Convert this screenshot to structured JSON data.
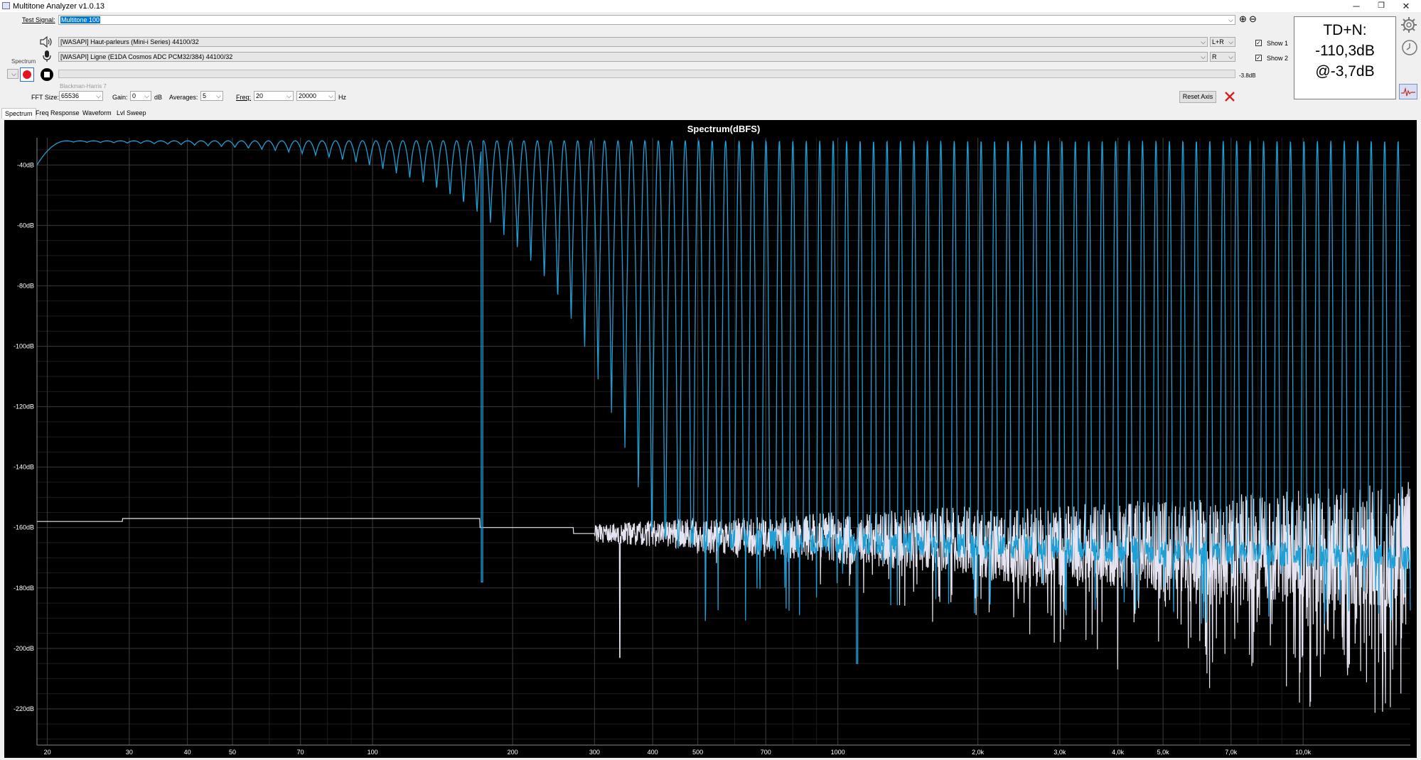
{
  "window": {
    "title": "Multitone Analyzer v1.0.13",
    "minimize_glyph": "─",
    "restore_glyph": "❐",
    "close_glyph": "✕"
  },
  "test_signal": {
    "label": "Test Signal:",
    "value": "Multitone 100",
    "add_icon": "⊕",
    "remove_icon": "⊖"
  },
  "output_device": {
    "value": "[WASAPI] Haut-parleurs (Mini-i Series) 44100/32",
    "channel": "L+R"
  },
  "input_device": {
    "value": "[WASAPI] Ligne (E1DA Cosmos ADC PCM32/384) 44100/32",
    "channel": "R"
  },
  "mode": {
    "label": "Spectrum"
  },
  "level": {
    "value": "-3.8dB",
    "fill_fraction": 0.0
  },
  "window_function": "Blackman-Harris 7",
  "fft_size": {
    "label": "FFT Size:",
    "value": "65536"
  },
  "gain": {
    "label": "Gain:",
    "value": "0",
    "unit": "dB"
  },
  "averages": {
    "label": "Averages:",
    "value": "5"
  },
  "freq": {
    "label": "Freq:",
    "from": "20",
    "to": "20000",
    "unit": "Hz"
  },
  "reset_axis": {
    "label": "Reset Axis"
  },
  "show1": {
    "label": "Show 1",
    "checked": true
  },
  "show2": {
    "label": "Show 2",
    "checked": true
  },
  "tdn": {
    "line1": "TD+N:",
    "line2": "-110,3dB",
    "line3": "@-3,7dB"
  },
  "tabs": [
    {
      "label": "Spectrum",
      "active": true
    },
    {
      "label": "Freq Response",
      "active": false
    },
    {
      "label": "Waveform",
      "active": false
    },
    {
      "label": "Lvl Sweep",
      "active": false
    }
  ],
  "colors": {
    "trace1": "#1e9fd6",
    "trace2": "#e6e4f0",
    "chart_bg": "#000000",
    "grid": "#3a3a3a",
    "record_red": "#e81123",
    "close_red": "#d42020"
  },
  "chart_data": {
    "type": "line",
    "title": "Spectrum(dBFS)",
    "x_scale": "log",
    "xlim": [
      19,
      17000
    ],
    "ylim": [
      -232,
      -31
    ],
    "y_ticks": [
      -40,
      -60,
      -80,
      -100,
      -120,
      -140,
      -160,
      -180,
      -200,
      -220
    ],
    "y_tick_labels": [
      "-40dB",
      "-60dB",
      "-80dB",
      "-100dB",
      "-120dB",
      "-140dB",
      "-160dB",
      "-180dB",
      "-200dB",
      "-220dB"
    ],
    "x_ticks": [
      20,
      30,
      40,
      50,
      70,
      100,
      200,
      300,
      400,
      500,
      700,
      1000,
      2000,
      3000,
      4000,
      5000,
      7000,
      10000
    ],
    "x_tick_labels": [
      "20",
      "30",
      "40",
      "50",
      "70",
      "100",
      "200",
      "300",
      "400",
      "500",
      "700",
      "1000",
      "2,0k",
      "3,0k",
      "4,0k",
      "5,0k",
      "7,0k",
      "10,0k"
    ],
    "grid": true,
    "series": [
      {
        "tone_count": 100,
        "tone_freq_range_hz": [
          22,
          16000
        ],
        "tone_peak_db": -32,
        "noise_floor_db": [
          -158,
          -170
        ],
        "deep_dips": [
          [
            172,
            -178
          ],
          [
            1100,
            -205
          ]
        ]
      },
      {
        "floor_db_by_freq": [
          [
            19,
            -158
          ],
          [
            27,
            -158
          ],
          [
            29,
            -157
          ],
          [
            100,
            -157
          ],
          [
            165,
            -157
          ],
          [
            170,
            -160
          ],
          [
            260,
            -160
          ],
          [
            270,
            -162
          ],
          [
            500,
            -163
          ],
          [
            1000,
            -164
          ],
          [
            2000,
            -166
          ],
          [
            16000,
            -165
          ]
        ],
        "deep_dips": [
          [
            340,
            -203
          ]
        ]
      }
    ]
  }
}
